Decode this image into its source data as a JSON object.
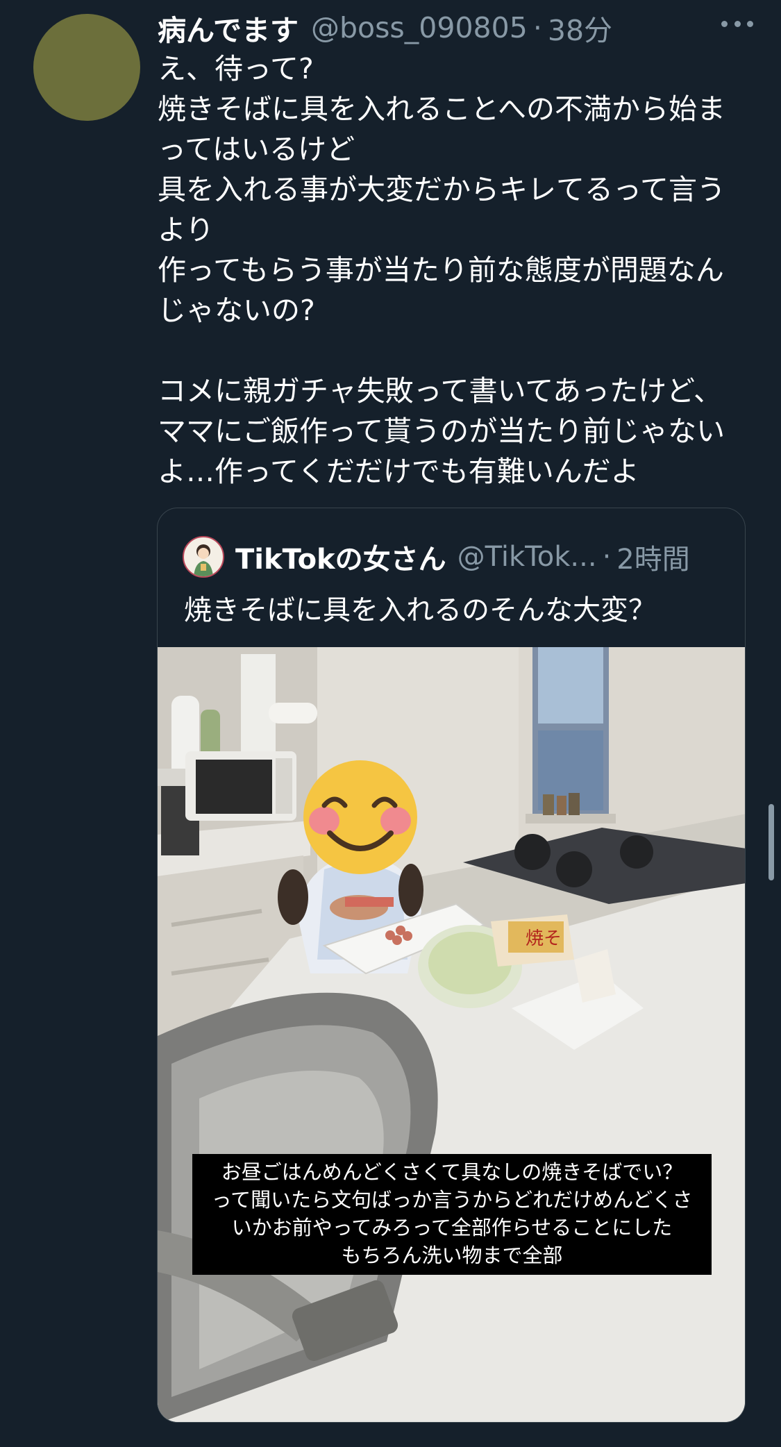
{
  "tweet": {
    "display_name": "病んでます",
    "handle": "@boss_090805",
    "separator": "·",
    "time": "38分",
    "lines": [
      "え、待って?",
      "焼きそばに具を入れることへの不満から始ま",
      "ってはいるけど",
      "具を入れる事が大変だからキレてるって言う",
      "より",
      "作ってもらう事が当たり前な態度が問題なん",
      "じゃないの?",
      "",
      "コメに親ガチャ失敗って書いてあったけど、",
      "ママにご飯作って貰うのが当たり前じゃない",
      "よ…作ってくだだけでも有難いんだよ"
    ]
  },
  "quote": {
    "display_name": "TikTokの女さん",
    "handle": "@TikTok...",
    "separator": "·",
    "time": "2時間",
    "text": "焼きそばに具を入れるのそんな大変？",
    "caption_lines": [
      "お昼ごはんめんどくさくて具なしの焼きそばでい？",
      "って聞いたら文句ばっか言うからどれだけめんどくさ",
      "いかお前やってみろって全部作らせることにした",
      "もちろん洗い物まで全部"
    ],
    "noodle_pack_label": "焼そ"
  },
  "icons": {
    "more": "more-horizontal-icon",
    "emoji": "smiling-face-with-blush-emoji"
  },
  "colors": {
    "background": "#15202b",
    "secondary_text": "#8899a6",
    "border": "#38444d",
    "avatar": "#6c6f3b"
  }
}
